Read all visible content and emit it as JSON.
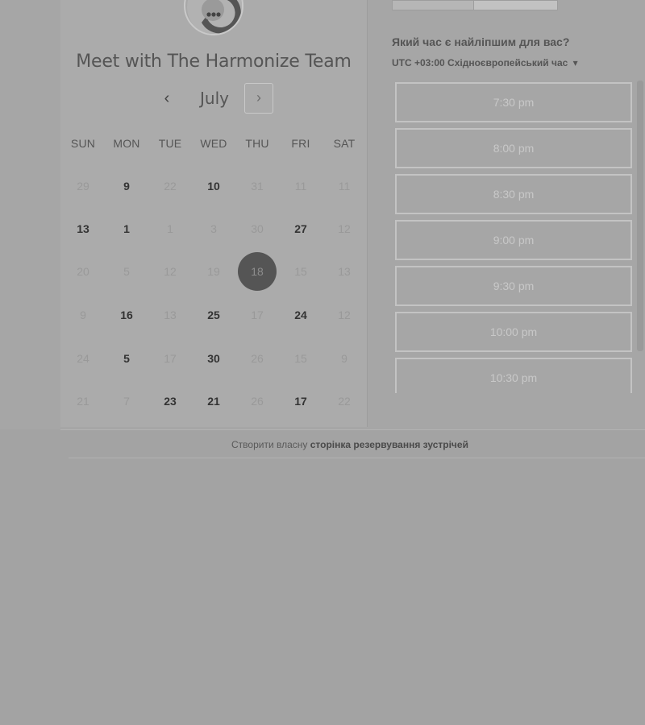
{
  "meeting": {
    "title": "Meet with The Harmonize Team"
  },
  "calendar": {
    "month": "July",
    "prev_icon": "‹",
    "next_icon": "›",
    "weekdays": [
      "SUN",
      "MON",
      "TUE",
      "WED",
      "THU",
      "FRI",
      "SAT"
    ],
    "weeks": [
      [
        {
          "d": "29",
          "s": "muted"
        },
        {
          "d": "9",
          "s": "avail"
        },
        {
          "d": "22",
          "s": "muted"
        },
        {
          "d": "10",
          "s": "avail"
        },
        {
          "d": "31",
          "s": "muted"
        },
        {
          "d": "11",
          "s": "muted"
        },
        {
          "d": "11",
          "s": "muted"
        }
      ],
      [
        {
          "d": "13",
          "s": "avail"
        },
        {
          "d": "1",
          "s": "avail"
        },
        {
          "d": "1",
          "s": "muted"
        },
        {
          "d": "3",
          "s": "muted"
        },
        {
          "d": "30",
          "s": "muted"
        },
        {
          "d": "27",
          "s": "avail"
        },
        {
          "d": "12",
          "s": "muted"
        }
      ],
      [
        {
          "d": "20",
          "s": "muted"
        },
        {
          "d": "5",
          "s": "muted"
        },
        {
          "d": "12",
          "s": "muted"
        },
        {
          "d": "19",
          "s": "muted"
        },
        {
          "d": "18",
          "s": "selected"
        },
        {
          "d": "15",
          "s": "muted"
        },
        {
          "d": "13",
          "s": "muted"
        }
      ],
      [
        {
          "d": "9",
          "s": "muted"
        },
        {
          "d": "16",
          "s": "avail"
        },
        {
          "d": "13",
          "s": "muted"
        },
        {
          "d": "25",
          "s": "avail"
        },
        {
          "d": "17",
          "s": "muted"
        },
        {
          "d": "24",
          "s": "avail"
        },
        {
          "d": "12",
          "s": "muted"
        }
      ],
      [
        {
          "d": "24",
          "s": "muted"
        },
        {
          "d": "5",
          "s": "avail"
        },
        {
          "d": "17",
          "s": "muted"
        },
        {
          "d": "30",
          "s": "avail"
        },
        {
          "d": "26",
          "s": "muted"
        },
        {
          "d": "15",
          "s": "muted"
        },
        {
          "d": "9",
          "s": "muted"
        }
      ],
      [
        {
          "d": "21",
          "s": "muted"
        },
        {
          "d": "7",
          "s": "muted"
        },
        {
          "d": "23",
          "s": "avail"
        },
        {
          "d": "21",
          "s": "avail"
        },
        {
          "d": "26",
          "s": "muted"
        },
        {
          "d": "17",
          "s": "avail"
        },
        {
          "d": "22",
          "s": "muted"
        }
      ]
    ]
  },
  "booking": {
    "question": "Який час є найліпшим для вас?",
    "timezone": "UTC +03:00 Східноєвропейський час",
    "timezone_icon": "▾",
    "slots": [
      "7:30 pm",
      "8:00 pm",
      "8:30 pm",
      "9:00 pm",
      "9:30 pm",
      "10:00 pm",
      "10:30 pm"
    ]
  },
  "footer": {
    "prefix": "Створити власну",
    "link": "сторінка резервування зустрічей"
  }
}
